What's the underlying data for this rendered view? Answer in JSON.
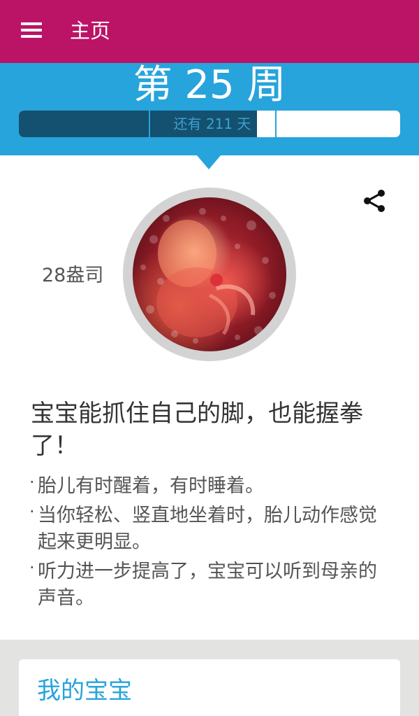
{
  "app_bar": {
    "title": "主页",
    "background": "#bb1366"
  },
  "week": {
    "title": "第 25 周",
    "remaining": "还有 211 天",
    "progress": 0.625,
    "accent": "#27a4db"
  },
  "baby": {
    "weight": "28盎司"
  },
  "headline": "宝宝能抓住自己的脚，也能握拳了！",
  "bullets": [
    "胎儿有时醒着，有时睡着。",
    "当你轻松、竖直地坐着时，胎儿动作感觉起来更明显。",
    "听力进一步提高了，宝宝可以听到母亲的声音。"
  ],
  "card": {
    "title": "我的宝宝"
  },
  "icons": {
    "menu": "menu-icon",
    "share": "share-icon"
  }
}
